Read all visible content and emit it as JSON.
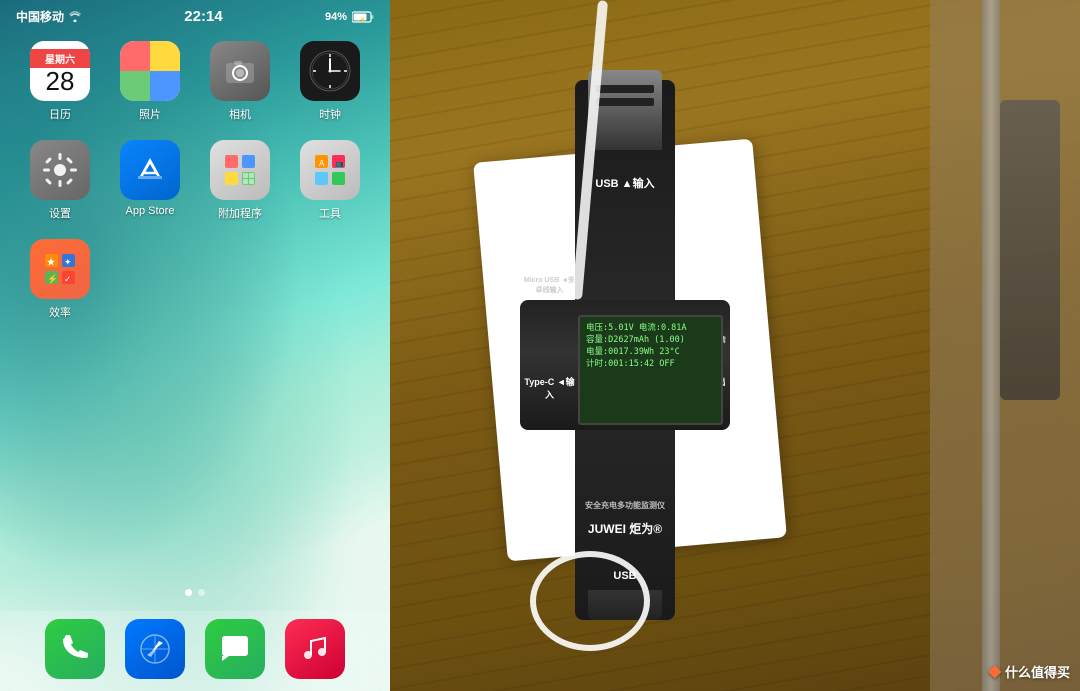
{
  "iphone": {
    "status_bar": {
      "carrier": "中国移动",
      "wifi": "wifi",
      "time": "22:14",
      "battery_icon": "94%",
      "battery_charging": true
    },
    "apps_row1": [
      {
        "name": "calendar",
        "label": "日历",
        "day": "28",
        "dow": "星期六"
      },
      {
        "name": "photos",
        "label": "照片"
      },
      {
        "name": "camera",
        "label": "相机"
      },
      {
        "name": "clock",
        "label": "时钟"
      }
    ],
    "apps_row2": [
      {
        "name": "settings",
        "label": "设置"
      },
      {
        "name": "appstore",
        "label": "App Store"
      },
      {
        "name": "utilities",
        "label": "附加程序"
      },
      {
        "name": "tools",
        "label": "工具"
      }
    ],
    "apps_row3": [
      {
        "name": "efficiency",
        "label": "效率"
      }
    ],
    "dock": [
      {
        "name": "phone",
        "label": "电话"
      },
      {
        "name": "safari",
        "label": "Safari"
      },
      {
        "name": "messages",
        "label": "信息"
      },
      {
        "name": "music",
        "label": "音乐"
      }
    ]
  },
  "usb_tester": {
    "display": {
      "line1": "电压:5.01V 电流:0.81A",
      "line2": "容量:D2627mAh (1.00)",
      "line3": "电量:0017.39Wh  23°C",
      "line4": "计时:001:15:42  OFF"
    },
    "labels": {
      "usb_input_top": "USB\n▲输入",
      "micro_usb": "Micro USB\n◄安卓线输入",
      "type_c_left": "Type-C\n◄输入",
      "type_c_right": "Type-C\n输出►",
      "display_switch": "显示切换\n数据清零",
      "device_description": "安全充电多功能监测仪",
      "brand": "JUWEI 炬为®",
      "usb_output_bottom": "USB"
    }
  },
  "watermark": {
    "text": "什么值得买"
  }
}
